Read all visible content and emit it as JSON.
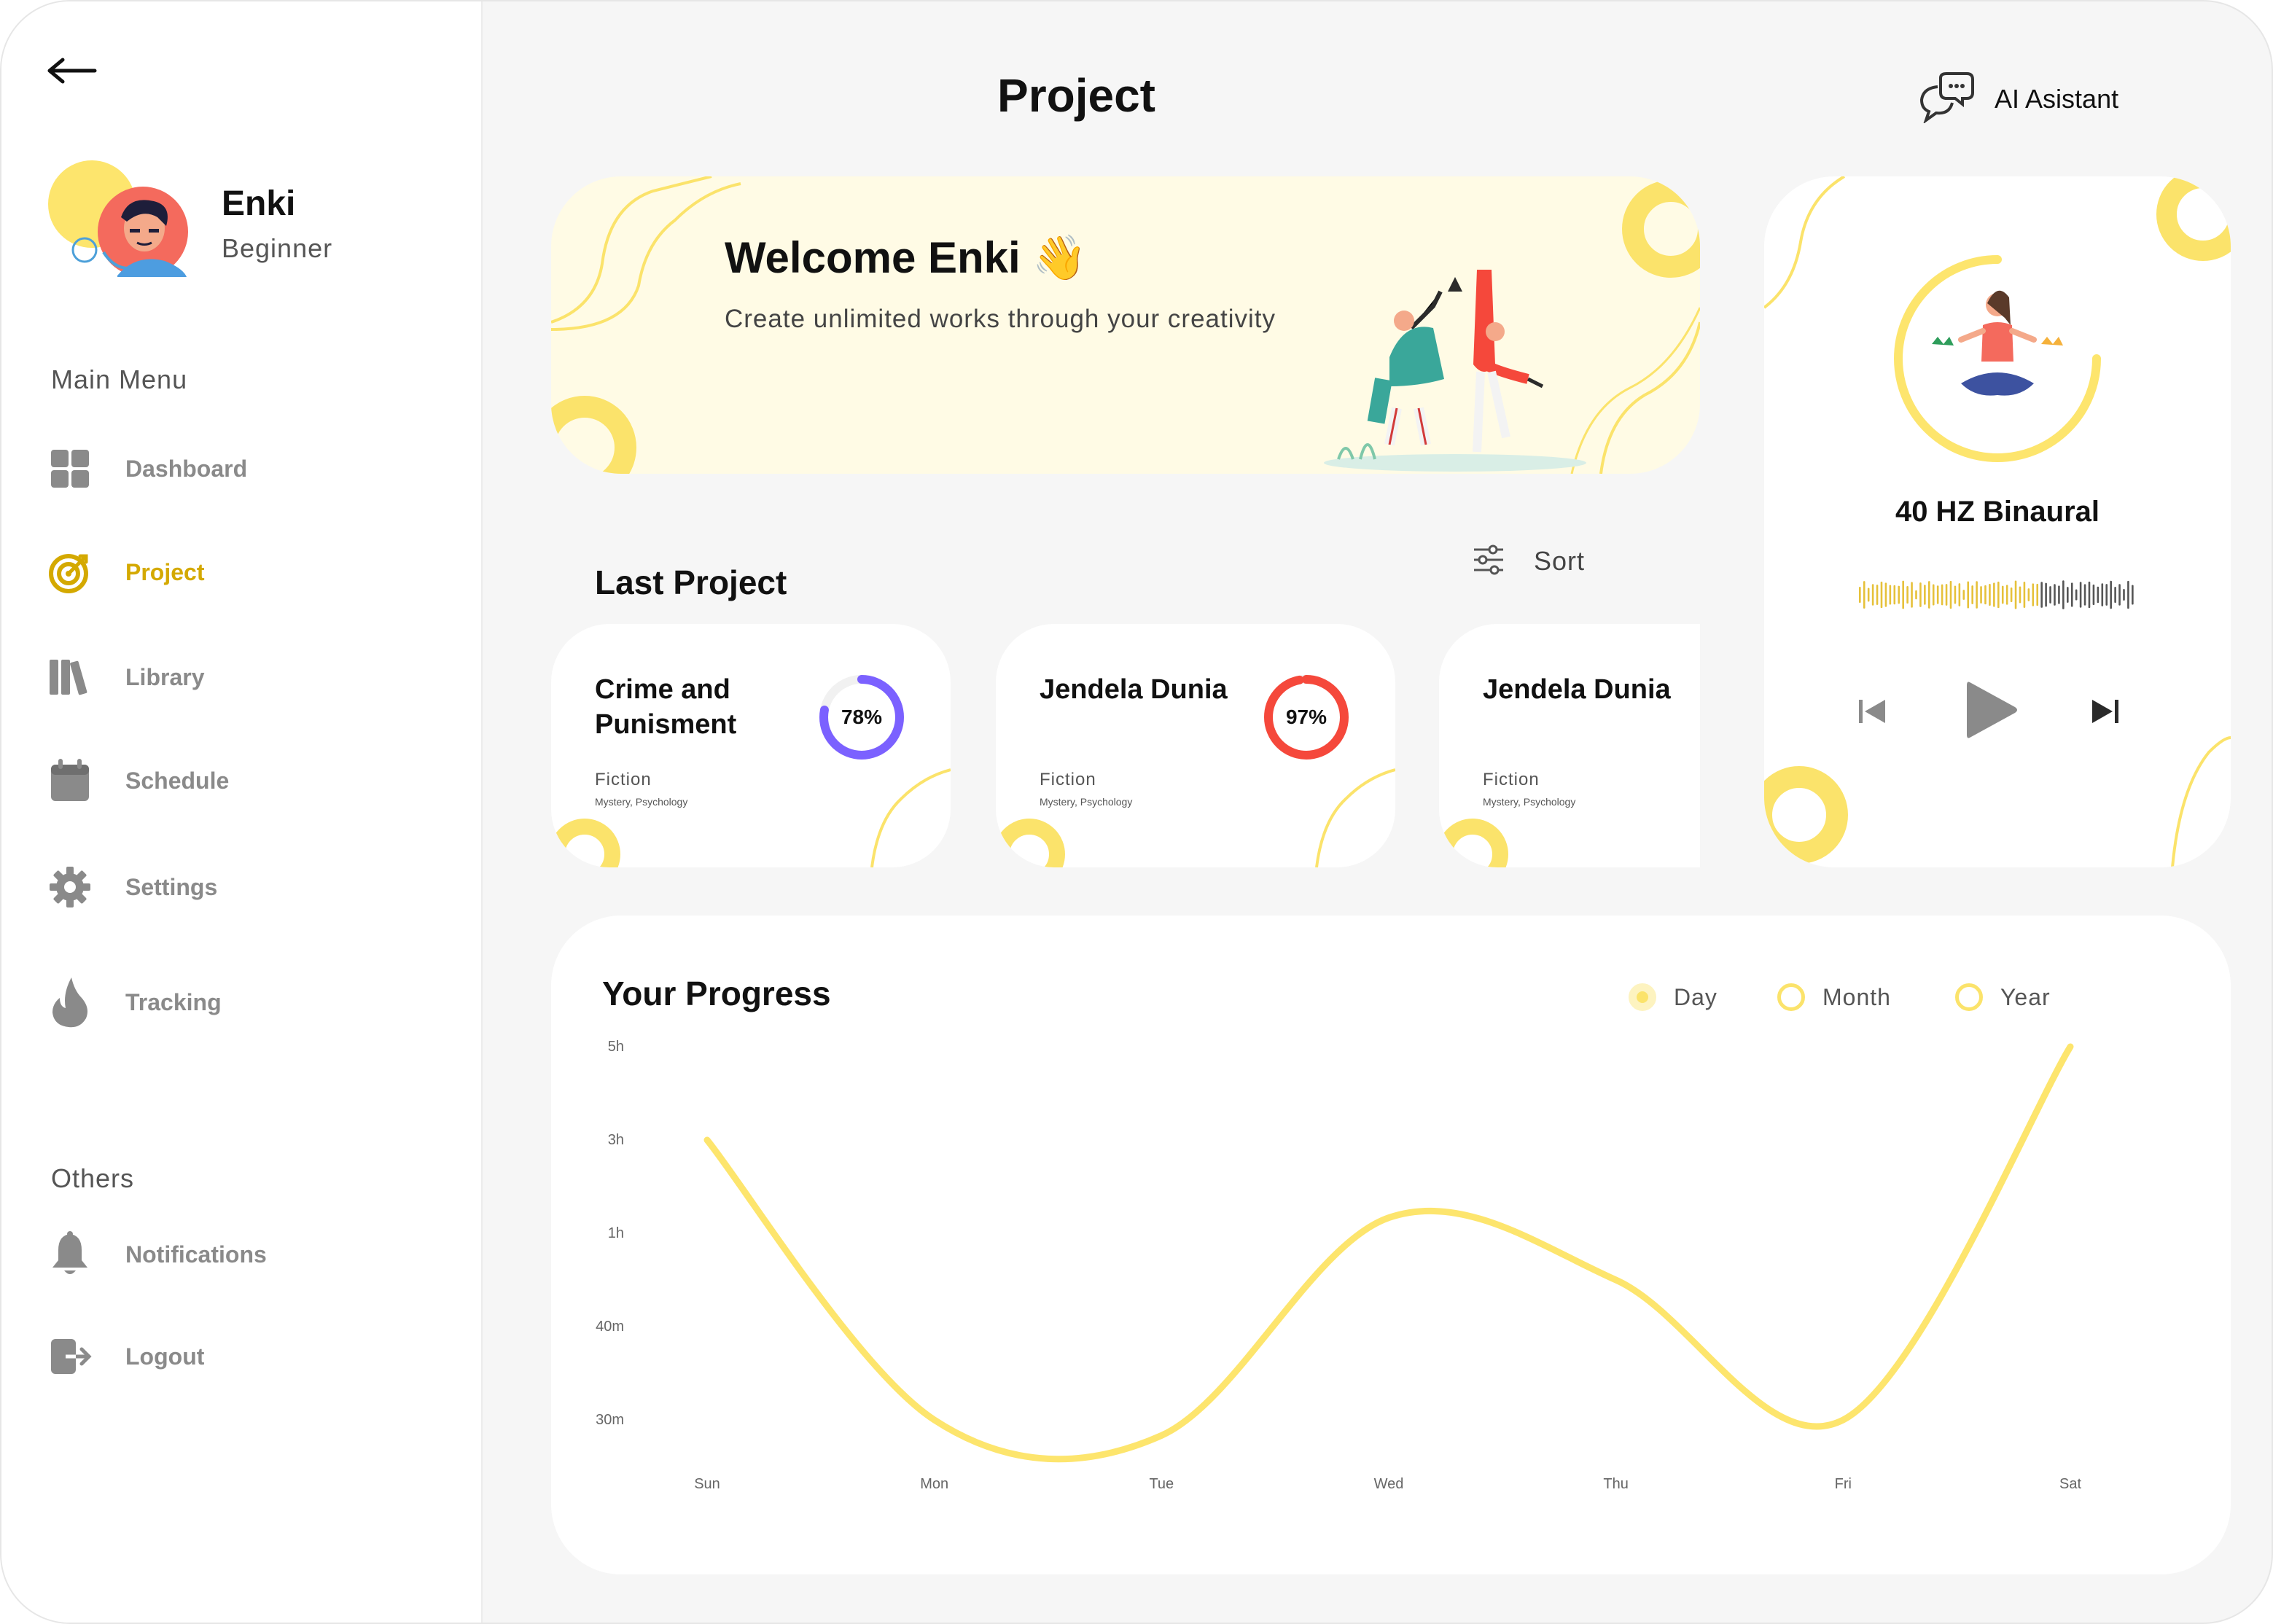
{
  "header": {
    "title": "Project",
    "ai_assistant_label": "AI Asistant",
    "ai_icon": "chat-bubbles-icon"
  },
  "profile": {
    "name": "Enki",
    "level": "Beginner"
  },
  "sidebar": {
    "main_menu_label": "Main Menu",
    "others_label": "Others",
    "items": [
      {
        "label": "Dashboard",
        "icon": "dashboard-grid-icon"
      },
      {
        "label": "Project",
        "icon": "target-icon",
        "active": true
      },
      {
        "label": "Library",
        "icon": "books-icon"
      },
      {
        "label": "Schedule",
        "icon": "calendar-icon"
      },
      {
        "label": "Settings",
        "icon": "gear-icon"
      },
      {
        "label": "Tracking",
        "icon": "flame-icon"
      }
    ],
    "others": [
      {
        "label": "Notifications",
        "icon": "bell-icon"
      },
      {
        "label": "Logout",
        "icon": "logout-icon"
      }
    ]
  },
  "welcome": {
    "title": "Welcome Enki 👋",
    "subtitle": "Create unlimited works through your creativity"
  },
  "last_project": {
    "title": "Last Project",
    "sort_label": "Sort",
    "cards": [
      {
        "title": "Crime and Punisment",
        "genre": "Fiction",
        "tags": "Mystery, Psychology",
        "percent": 78,
        "percent_label": "78%",
        "color": "#7b61ff"
      },
      {
        "title": "Jendela Dunia",
        "genre": "Fiction",
        "tags": "Mystery, Psychology",
        "percent": 97,
        "percent_label": "97%",
        "color": "#f5483b"
      },
      {
        "title": "Jendela Dunia",
        "genre": "Fiction",
        "tags": "Mystery, Psychology",
        "percent": null,
        "percent_label": "",
        "color": "#f5483b"
      }
    ]
  },
  "music": {
    "track": "40 HZ Binaural",
    "progress": 0.65
  },
  "progress": {
    "title": "Your Progress",
    "range_options": [
      {
        "label": "Day",
        "selected": true
      },
      {
        "label": "Month",
        "selected": false
      },
      {
        "label": "Year",
        "selected": false
      }
    ]
  },
  "chart_data": {
    "type": "line",
    "title": "Your Progress",
    "x": [
      "Sun",
      "Mon",
      "Tue",
      "Wed",
      "Thu",
      "Fri",
      "Sat"
    ],
    "y_ticks": [
      "5h",
      "3h",
      "1h",
      "40m",
      "30m"
    ],
    "series": [
      {
        "values": [
          "3h",
          "30m",
          "25m",
          "1h 20m",
          "50m",
          "30m",
          "5h"
        ]
      }
    ],
    "color": "#fde56d",
    "smooth": true,
    "grid": false
  },
  "colors": {
    "accent": "#fde56d",
    "active_nav": "#d4a900",
    "banner_bg": "#fffbe5",
    "page_bg": "#f6f6f6"
  }
}
